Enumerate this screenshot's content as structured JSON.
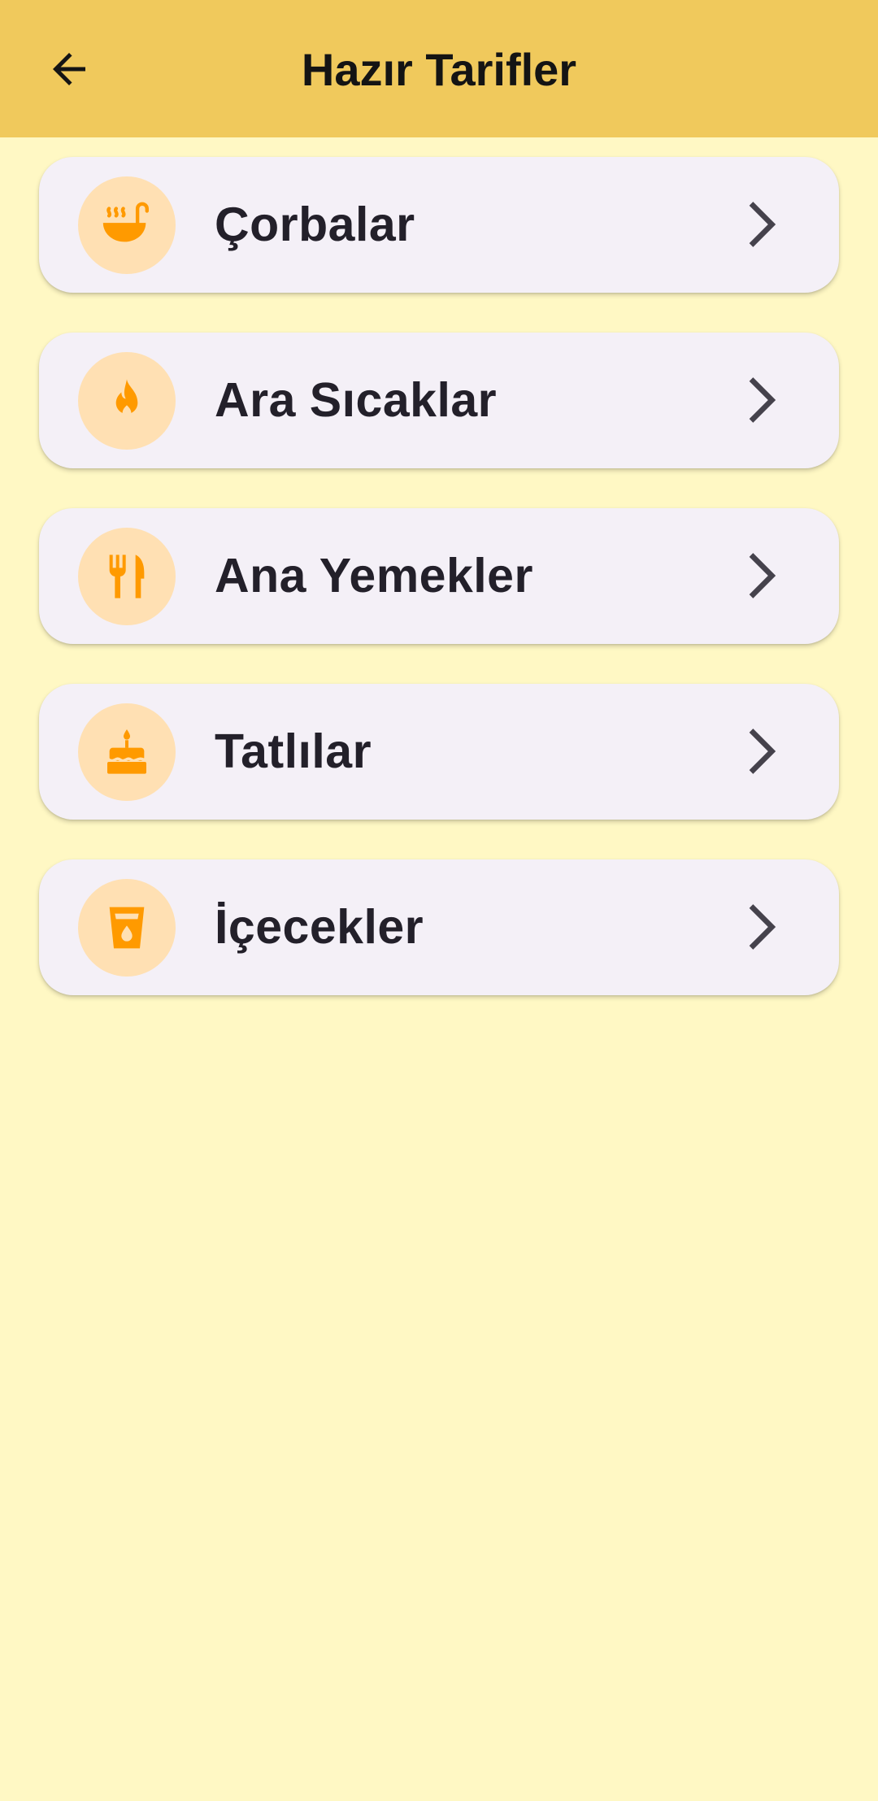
{
  "app_bar": {
    "title": "Hazır Tarifler",
    "back_icon": "arrow-back-icon",
    "background": "#F0C95C"
  },
  "categories": [
    {
      "label": "Çorbalar",
      "icon": "soup-ladle-icon"
    },
    {
      "label": "Ara Sıcaklar",
      "icon": "fire-icon"
    },
    {
      "label": "Ana Yemekler",
      "icon": "fork-knife-icon"
    },
    {
      "label": "Tatlılar",
      "icon": "cake-icon"
    },
    {
      "label": "İçecekler",
      "icon": "drink-glass-icon"
    }
  ],
  "colors": {
    "page_background": "#FFF8C4",
    "card_background": "#F4F0F7",
    "icon_circle": "#FFE0B3",
    "icon_accent": "#FF9A00",
    "chevron": "#45424C"
  }
}
